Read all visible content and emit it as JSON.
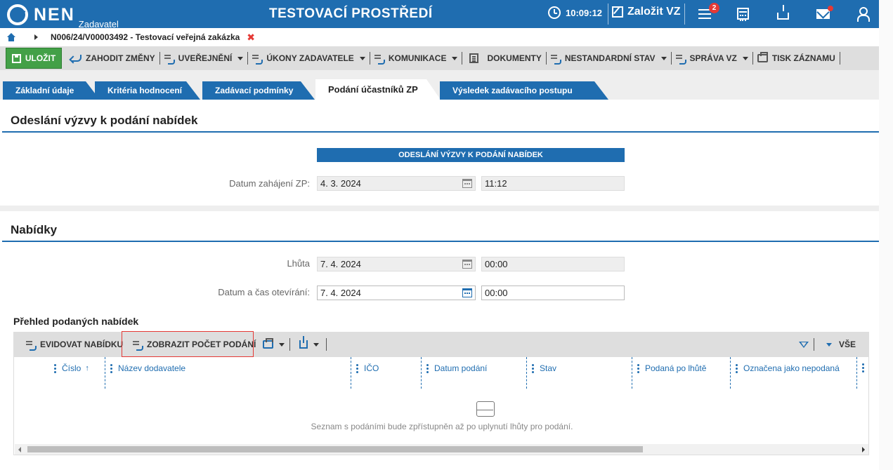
{
  "header": {
    "logo_text": "NEN",
    "logo_sub": "Zadavatel",
    "env_title": "TESTOVACÍ PROSTŘEDÍ",
    "time": "10:09:12",
    "create_label": "Založit VZ",
    "menu_badge": "2",
    "accent_color": "#1f6db0",
    "icons": [
      "clock-icon",
      "edit-icon",
      "menu-icon",
      "calculator-icon",
      "inbox-icon",
      "mail-icon",
      "user-icon"
    ]
  },
  "breadcrumb": {
    "text": "N006/24/V00003492 - Testovací veřejná zakázka",
    "close": "✖"
  },
  "toolbar": {
    "save": "ULOŽIT",
    "discard": "ZAHODIT ZMĚNY",
    "publish": "UVEŘEJNĚNÍ",
    "actions": "ÚKONY ZADAVATELE",
    "communication": "KOMUNIKACE",
    "documents": "DOKUMENTY",
    "nonstandard": "NESTANDARDNÍ STAV",
    "management": "SPRÁVA VZ",
    "print": "TISK ZÁZNAMU"
  },
  "tabs": [
    {
      "label": "Základní údaje"
    },
    {
      "label": "Kritéria hodnocení"
    },
    {
      "label": "Zadávací podmínky"
    },
    {
      "label": "Podání účastníků ZP"
    },
    {
      "label": "Výsledek zadávacího postupu"
    }
  ],
  "invite_panel": {
    "title": "Odeslání výzvy k podání nabídek",
    "subheader": "ODESLÁNÍ VÝZVY K PODÁNÍ NABÍDEK",
    "start_label": "Datum zahájení ZP:",
    "start_date": "4. 3. 2024",
    "start_time": "11:12"
  },
  "offers_panel": {
    "title": "Nabídky",
    "deadline_label": "Lhůta",
    "deadline_date": "7. 4. 2024",
    "deadline_time": "00:00",
    "opening_label": "Datum a čas otevírání:",
    "opening_date": "7. 4. 2024",
    "opening_time": "00:00"
  },
  "grid": {
    "title": "Přehled podaných nabídek",
    "register_btn": "EVIDOVAT NABÍDKU",
    "count_btn": "ZOBRAZIT POČET PODÁNÍ",
    "all_label": "VŠE",
    "columns": [
      "Číslo",
      "Název dodavatele",
      "IČO",
      "Datum podání",
      "Stav",
      "Podaná po lhůtě",
      "Označena jako nepodaná"
    ],
    "sort_indicator": "↑",
    "empty_message": "Seznam s podáními bude zpřístupněn až po uplynutí lhůty pro podání."
  }
}
